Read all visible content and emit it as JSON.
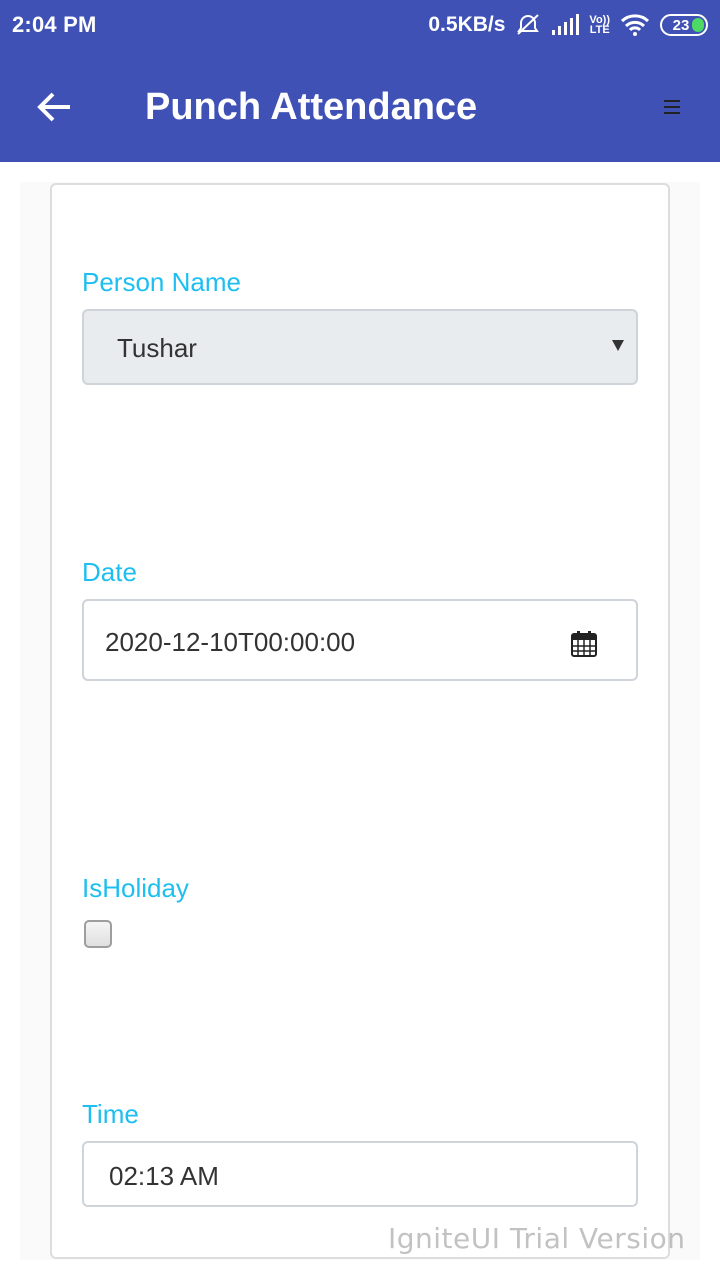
{
  "status_bar": {
    "time": "2:04 PM",
    "net_speed": "0.5KB/s",
    "lte_top": "Vo))",
    "lte_bottom": "LTE",
    "battery": "23"
  },
  "app_bar": {
    "title": "Punch Attendance",
    "back_icon": "arrow-left-icon",
    "menu_icon": "hamburger-menu-icon",
    "color": "#3f51b5"
  },
  "form": {
    "person_name_label": "Person Name",
    "person_name_value": "Tushar",
    "date_label": "Date",
    "date_value": "2020-12-10T00:00:00",
    "is_holiday_label": "IsHoliday",
    "is_holiday_checked": false,
    "time_label": "Time",
    "time_value": "02:13 AM",
    "label_color": "#1ebff0"
  },
  "watermark": "IgniteUI Trial Version"
}
